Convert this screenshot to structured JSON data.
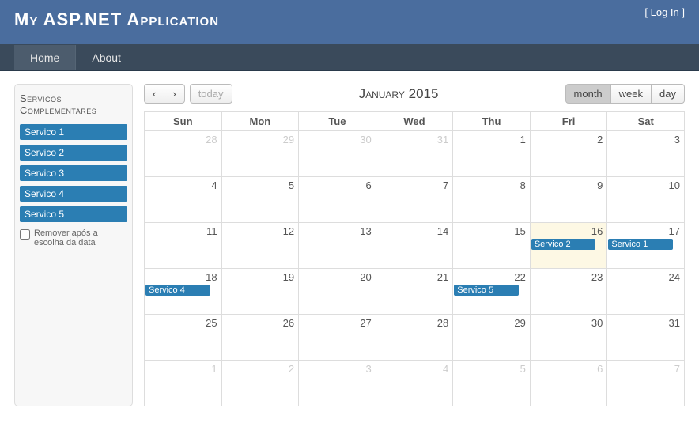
{
  "header": {
    "title": "My ASP.NET Application",
    "login": "Log In"
  },
  "nav": {
    "home": "Home",
    "about": "About"
  },
  "sidebar": {
    "title": "Servicos Complementares",
    "items": [
      "Servico 1",
      "Servico 2",
      "Servico 3",
      "Servico 4",
      "Servico 5"
    ],
    "remove_label": "Remover após a escolha da data"
  },
  "calendar": {
    "prev": "‹",
    "next": "›",
    "today": "today",
    "title": "January 2015",
    "view_month": "month",
    "view_week": "week",
    "view_day": "day",
    "day_headers": [
      "Sun",
      "Mon",
      "Tue",
      "Wed",
      "Thu",
      "Fri",
      "Sat"
    ],
    "weeks": [
      {
        "days": [
          {
            "n": 28,
            "other": true
          },
          {
            "n": 29,
            "other": true
          },
          {
            "n": 30,
            "other": true
          },
          {
            "n": 31,
            "other": true
          },
          {
            "n": 1
          },
          {
            "n": 2
          },
          {
            "n": 3
          }
        ]
      },
      {
        "days": [
          {
            "n": 4
          },
          {
            "n": 5
          },
          {
            "n": 6
          },
          {
            "n": 7
          },
          {
            "n": 8
          },
          {
            "n": 9
          },
          {
            "n": 10
          }
        ]
      },
      {
        "days": [
          {
            "n": 11
          },
          {
            "n": 12
          },
          {
            "n": 13
          },
          {
            "n": 14
          },
          {
            "n": 15
          },
          {
            "n": 16,
            "today": true,
            "event": "Servico 2"
          },
          {
            "n": 17,
            "event": "Servico 1"
          }
        ]
      },
      {
        "days": [
          {
            "n": 18,
            "event": "Servico 4"
          },
          {
            "n": 19
          },
          {
            "n": 20
          },
          {
            "n": 21
          },
          {
            "n": 22,
            "event": "Servico 5"
          },
          {
            "n": 23
          },
          {
            "n": 24
          }
        ]
      },
      {
        "days": [
          {
            "n": 25
          },
          {
            "n": 26
          },
          {
            "n": 27
          },
          {
            "n": 28
          },
          {
            "n": 29
          },
          {
            "n": 30
          },
          {
            "n": 31
          }
        ]
      },
      {
        "days": [
          {
            "n": 1,
            "other": true
          },
          {
            "n": 2,
            "other": true
          },
          {
            "n": 3,
            "other": true
          },
          {
            "n": 4,
            "other": true
          },
          {
            "n": 5,
            "other": true
          },
          {
            "n": 6,
            "other": true
          },
          {
            "n": 7,
            "other": true
          }
        ]
      }
    ]
  }
}
